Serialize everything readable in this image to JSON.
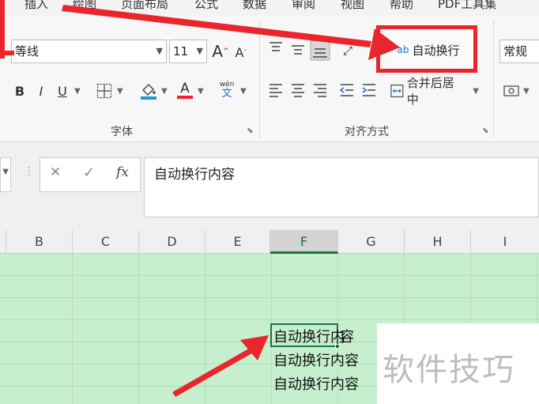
{
  "menu": {
    "tabs": [
      "插入",
      "绘图",
      "页面布局",
      "公式",
      "数据",
      "审阅",
      "视图",
      "帮助",
      "PDF工具集"
    ]
  },
  "font_group": {
    "font_name": "等线",
    "font_size": "11",
    "grow_label": "A",
    "shrink_label": "A",
    "bold": "B",
    "italic": "I",
    "underline": "U",
    "font_color_label": "A",
    "phonetic_top": "wén",
    "phonetic_bottom": "文",
    "label": "字体"
  },
  "align_group": {
    "wrap_text": "自动换行",
    "wrap_icon_text": "ab",
    "merge_center": "合并后居中",
    "label": "对齐方式"
  },
  "number_group": {
    "format": "常规"
  },
  "formula_bar": {
    "cancel": "✕",
    "enter": "✓",
    "fx": "fx",
    "content": "自动换行内容"
  },
  "columns": [
    "B",
    "C",
    "D",
    "E",
    "F",
    "G",
    "H",
    "I"
  ],
  "active_column": "F",
  "cells": [
    "自动换行内",
    "容",
    "自动换行内容",
    "自动换行内容"
  ],
  "watermark": "软件技巧",
  "colors": {
    "highlight": "#e8262b",
    "sheet_fill": "#c6efce",
    "selection": "#1e7145"
  }
}
